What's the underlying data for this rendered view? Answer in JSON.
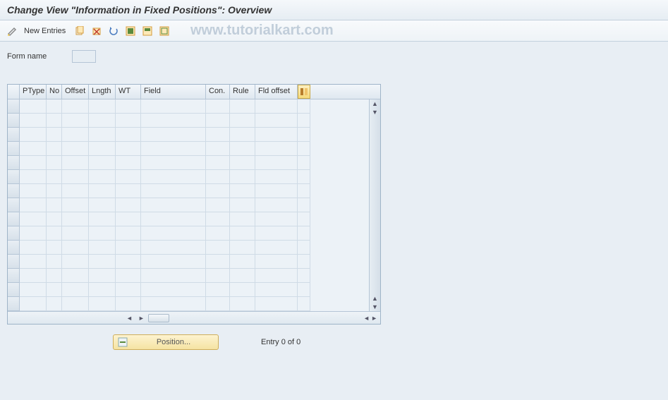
{
  "title": "Change View \"Information in Fixed Positions\": Overview",
  "toolbar": {
    "new_entries": "New Entries"
  },
  "form": {
    "name_label": "Form name",
    "name_value": ""
  },
  "table": {
    "columns": [
      "PType",
      "No",
      "Offset",
      "Lngth",
      "WT",
      "Field",
      "Con.",
      "Rule",
      "Fld offset"
    ],
    "row_count": 15
  },
  "footer": {
    "position_btn": "Position...",
    "entry_text": "Entry 0 of 0"
  },
  "watermark": "www.tutorialkart.com"
}
